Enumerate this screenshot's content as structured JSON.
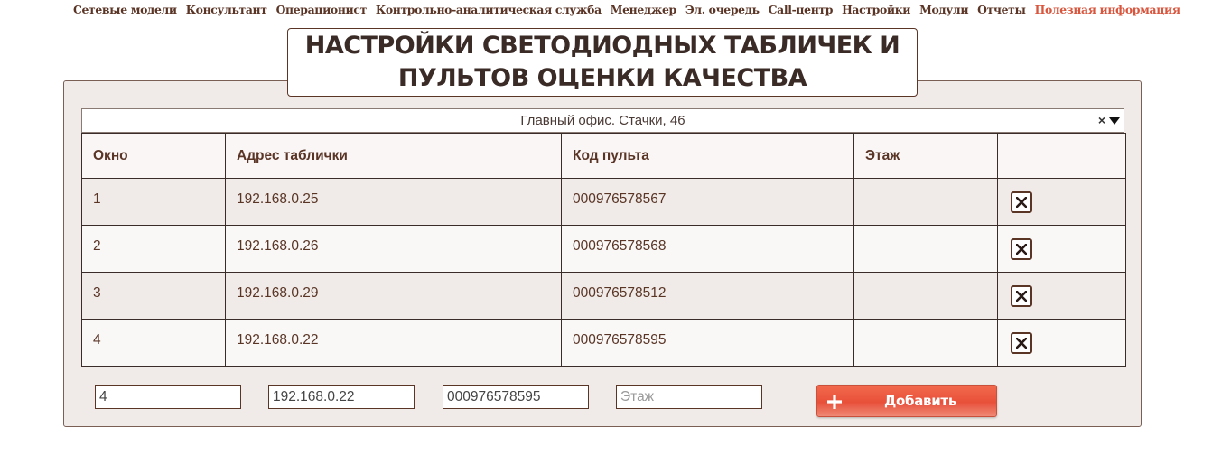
{
  "nav": {
    "items": [
      "Сетевые модели",
      "Консультант",
      "Операционист",
      "Контрольно-аналитическая служба",
      "Менеджер",
      "Эл. очередь",
      "Call-центр",
      "Настройки",
      "Модули",
      "Отчеты",
      "Полезная информация"
    ],
    "active_item": "Полезная информация",
    "accent_color": "#d9563e"
  },
  "page": {
    "title": "НАСТРОЙКИ СВЕТОДИОДНЫХ ТАБЛИЧЕК И\nПУЛЬТОВ ОЦЕНКИ КАЧЕСТВА"
  },
  "office_select": {
    "value": "Главный офис. Стачки, 46",
    "clear_symbol": "×"
  },
  "table": {
    "headers": [
      "Окно",
      "Адрес таблички",
      "Код пульта",
      "Этаж",
      ""
    ],
    "rows": [
      {
        "window": "1",
        "address": "192.168.0.25",
        "code": "000976578567",
        "floor": ""
      },
      {
        "window": "2",
        "address": "192.168.0.26",
        "code": "000976578568",
        "floor": ""
      },
      {
        "window": "3",
        "address": "192.168.0.29",
        "code": "000976578512",
        "floor": ""
      },
      {
        "window": "4",
        "address": "192.168.0.22",
        "code": "000976578595",
        "floor": ""
      }
    ]
  },
  "add_form": {
    "window_value": "4",
    "address_value": "192.168.0.22",
    "code_value": "000976578595",
    "floor_value": "",
    "floor_placeholder": "Этаж",
    "add_label": "Добавить"
  },
  "icons": {
    "delete": "close-x-icon",
    "add": "plus-icon"
  }
}
